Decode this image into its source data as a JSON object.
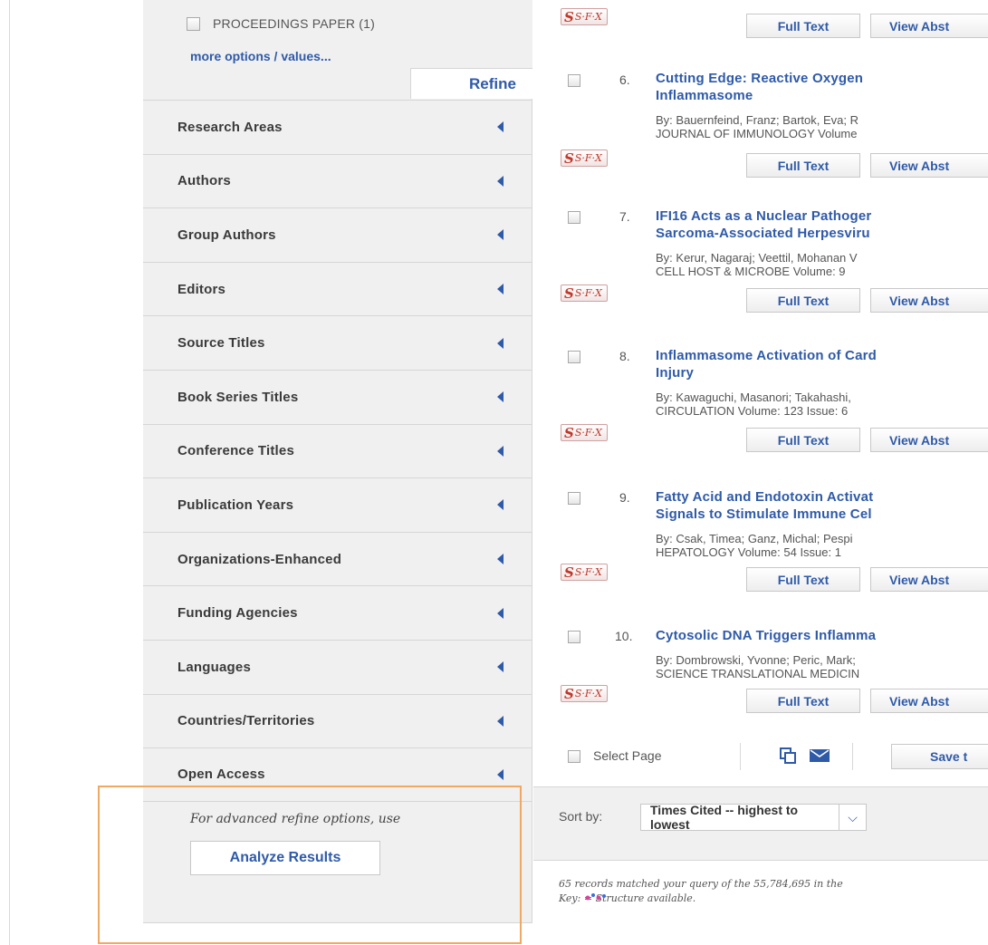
{
  "sidebar": {
    "checkbox_label": "PROCEEDINGS PAPER (1)",
    "more_link": "more options / values...",
    "refine_label": "Refine",
    "facets": [
      {
        "label": "Research Areas"
      },
      {
        "label": "Authors"
      },
      {
        "label": "Group Authors"
      },
      {
        "label": "Editors"
      },
      {
        "label": "Source Titles"
      },
      {
        "label": "Book Series Titles"
      },
      {
        "label": "Conference Titles"
      },
      {
        "label": "Publication Years"
      },
      {
        "label": "Organizations-Enhanced"
      },
      {
        "label": "Funding Agencies"
      },
      {
        "label": "Languages"
      },
      {
        "label": "Countries/Territories"
      },
      {
        "label": "Open Access"
      }
    ],
    "advanced_text": "For advanced refine options, use",
    "analyze_button": "Analyze Results"
  },
  "results": {
    "sfx_label": "S·F·X",
    "full_text": "Full Text",
    "view_abstract": "View Abst",
    "records": [
      {
        "num": "6.",
        "title1": "Cutting Edge: Reactive Oxygen",
        "title2": "Inflammasome",
        "authors": "By: Bauernfeind, Franz; Bartok, Eva; R",
        "source": "JOURNAL OF IMMUNOLOGY  Volume"
      },
      {
        "num": "7.",
        "title1": "IFI16 Acts as a Nuclear Pathoger",
        "title2": "Sarcoma-Associated Herpesviru",
        "authors": "By: Kerur, Nagaraj; Veettil, Mohanan V",
        "source": "CELL HOST & MICROBE  Volume: 9"
      },
      {
        "num": "8.",
        "title1": "Inflammasome Activation of Card",
        "title2": "Injury",
        "authors": "By: Kawaguchi, Masanori; Takahashi, ",
        "source": "CIRCULATION  Volume: 123  Issue: 6"
      },
      {
        "num": "9.",
        "title1": "Fatty Acid and Endotoxin Activat",
        "title2": "Signals to Stimulate Immune Cel",
        "authors": "By: Csak, Timea; Ganz, Michal; Pespi",
        "source": "HEPATOLOGY  Volume: 54  Issue: 1"
      },
      {
        "num": "10.",
        "title1": "Cytosolic DNA Triggers Inflamma",
        "title2": "",
        "authors": "By: Dombrowski, Yvonne; Peric, Mark;",
        "source": "SCIENCE TRANSLATIONAL MEDICIN"
      }
    ],
    "select_page": "Select Page",
    "save_label": "Save t",
    "sort_label": "Sort by:",
    "sort_value": "Times Cited -- highest to lowest",
    "footer_line1": "65 records matched your query of the 55,784,695 in the",
    "footer_line2": "Key:        = Structure available."
  }
}
